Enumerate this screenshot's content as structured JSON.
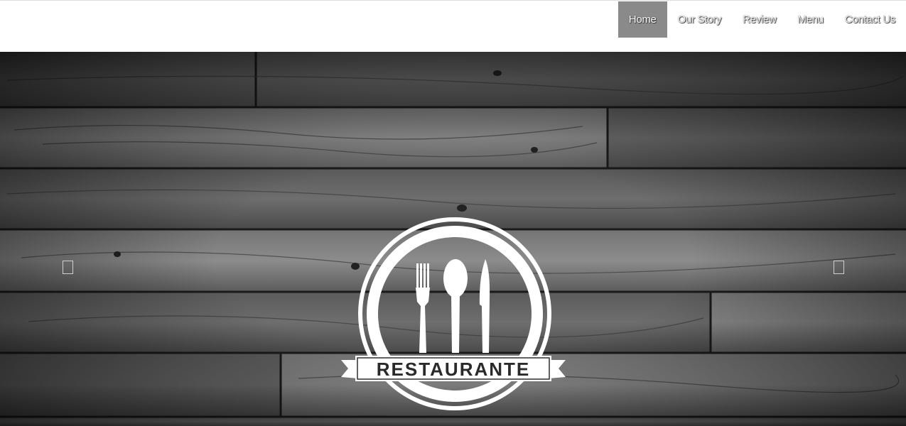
{
  "nav": {
    "items": [
      {
        "label": "Home",
        "active": true
      },
      {
        "label": "Our Story",
        "active": false
      },
      {
        "label": "Review",
        "active": false
      },
      {
        "label": "Menu",
        "active": false
      },
      {
        "label": "Contact Us",
        "active": false
      }
    ]
  },
  "hero": {
    "logo_text": "RESTAURANTE",
    "prev_icon": "slider-prev-icon",
    "next_icon": "slider-next-icon"
  },
  "colors": {
    "active_nav_bg": "#8a8a8a",
    "nav_text": "#f2f2f2",
    "logo": "#ffffff"
  }
}
